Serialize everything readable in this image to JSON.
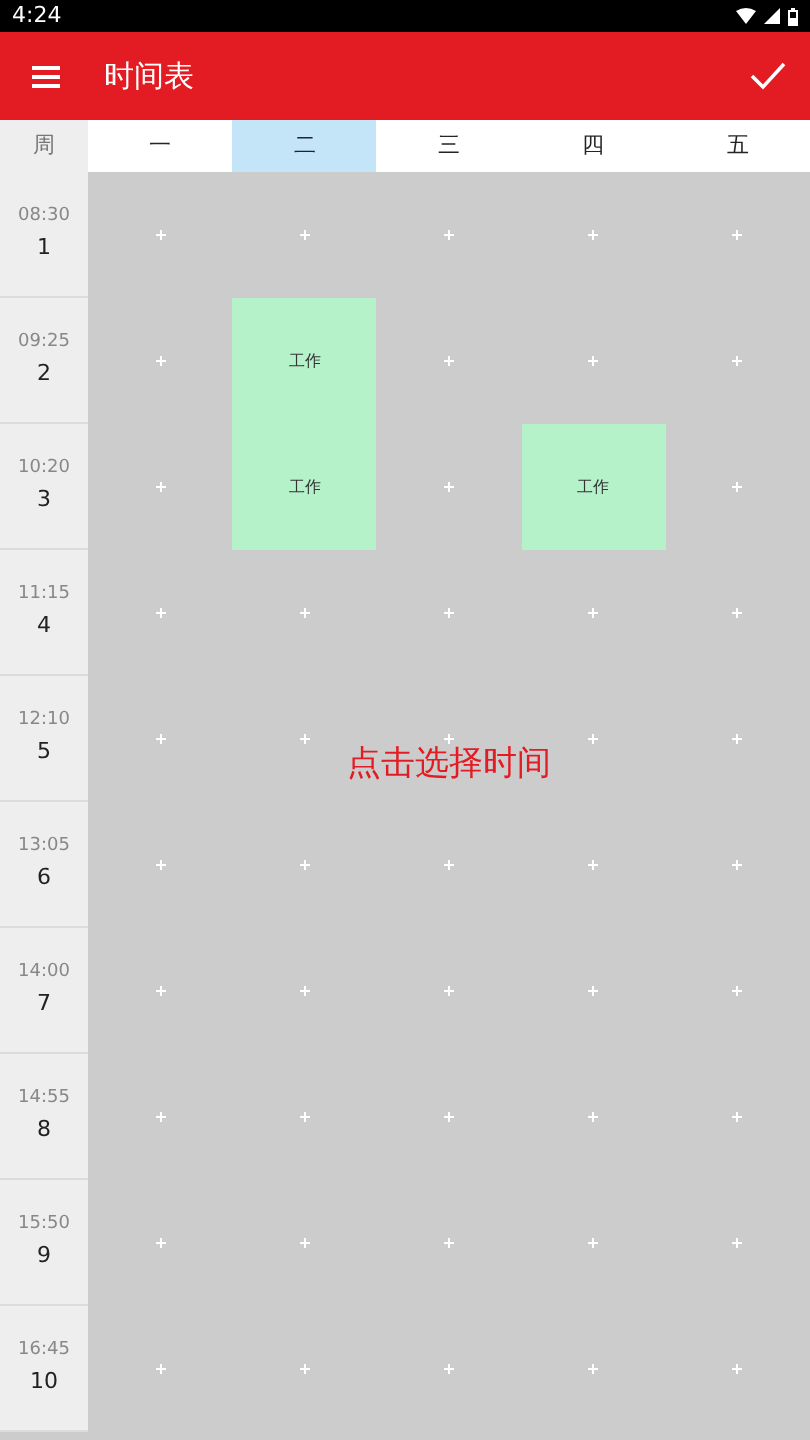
{
  "status_bar": {
    "time": "4:24"
  },
  "app_bar": {
    "title": "时间表"
  },
  "header": {
    "corner": "周",
    "days": [
      {
        "label": "一",
        "selected": false
      },
      {
        "label": "二",
        "selected": true
      },
      {
        "label": "三",
        "selected": false
      },
      {
        "label": "四",
        "selected": false
      },
      {
        "label": "五",
        "selected": false
      }
    ]
  },
  "rows": [
    {
      "time": "08:30",
      "number": "1",
      "slots": [
        {
          "kind": "empty"
        },
        {
          "kind": "empty"
        },
        {
          "kind": "empty"
        },
        {
          "kind": "empty"
        },
        {
          "kind": "empty"
        }
      ]
    },
    {
      "time": "09:25",
      "number": "2",
      "slots": [
        {
          "kind": "empty"
        },
        {
          "kind": "event",
          "label": "工作"
        },
        {
          "kind": "empty"
        },
        {
          "kind": "empty"
        },
        {
          "kind": "empty"
        }
      ]
    },
    {
      "time": "10:20",
      "number": "3",
      "slots": [
        {
          "kind": "empty"
        },
        {
          "kind": "event",
          "label": "工作"
        },
        {
          "kind": "empty"
        },
        {
          "kind": "event",
          "label": "工作"
        },
        {
          "kind": "empty"
        }
      ]
    },
    {
      "time": "11:15",
      "number": "4",
      "slots": [
        {
          "kind": "empty"
        },
        {
          "kind": "empty"
        },
        {
          "kind": "empty"
        },
        {
          "kind": "empty"
        },
        {
          "kind": "empty"
        }
      ]
    },
    {
      "time": "12:10",
      "number": "5",
      "slots": [
        {
          "kind": "empty"
        },
        {
          "kind": "empty"
        },
        {
          "kind": "empty"
        },
        {
          "kind": "empty"
        },
        {
          "kind": "empty"
        }
      ]
    },
    {
      "time": "13:05",
      "number": "6",
      "slots": [
        {
          "kind": "empty"
        },
        {
          "kind": "empty"
        },
        {
          "kind": "empty"
        },
        {
          "kind": "empty"
        },
        {
          "kind": "empty"
        }
      ]
    },
    {
      "time": "14:00",
      "number": "7",
      "slots": [
        {
          "kind": "empty"
        },
        {
          "kind": "empty"
        },
        {
          "kind": "empty"
        },
        {
          "kind": "empty"
        },
        {
          "kind": "empty"
        }
      ]
    },
    {
      "time": "14:55",
      "number": "8",
      "slots": [
        {
          "kind": "empty"
        },
        {
          "kind": "empty"
        },
        {
          "kind": "empty"
        },
        {
          "kind": "empty"
        },
        {
          "kind": "empty"
        }
      ]
    },
    {
      "time": "15:50",
      "number": "9",
      "slots": [
        {
          "kind": "empty"
        },
        {
          "kind": "empty"
        },
        {
          "kind": "empty"
        },
        {
          "kind": "empty"
        },
        {
          "kind": "empty"
        }
      ]
    },
    {
      "time": "16:45",
      "number": "10",
      "slots": [
        {
          "kind": "empty"
        },
        {
          "kind": "empty"
        },
        {
          "kind": "empty"
        },
        {
          "kind": "empty"
        },
        {
          "kind": "empty"
        }
      ]
    }
  ],
  "hint": "点击选择时间"
}
